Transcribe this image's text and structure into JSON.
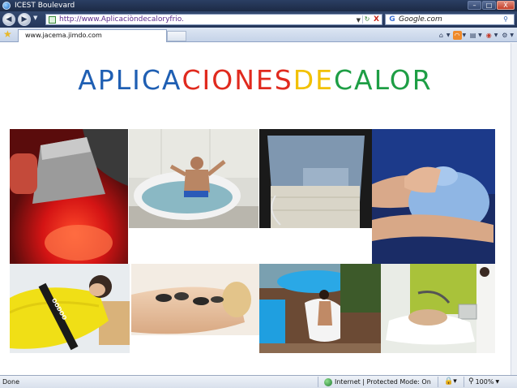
{
  "window": {
    "title": "ICEST Boulevard",
    "buttons": {
      "minimize": "–",
      "maximize": "□",
      "close": "X"
    }
  },
  "address_bar": {
    "url": "http://www.Aplicaciòndecaloryfrio.",
    "refresh_glyph": "↻",
    "stop_glyph": "X"
  },
  "search": {
    "value": "Google.com",
    "button_glyph": "⚲"
  },
  "tabs": [
    {
      "label": "www.jacema.jimdo.com"
    }
  ],
  "page": {
    "title_parts": [
      {
        "text": "APLICA",
        "color": "#1f5fb3"
      },
      {
        "text": "CIONES",
        "color": "#e02a1e"
      },
      {
        "text": " ",
        "color": "#000000"
      },
      {
        "text": "DE",
        "color": "#f2c100"
      },
      {
        "text": " ",
        "color": "#000000"
      },
      {
        "text": "CALOR",
        "color": "#1e9e45"
      }
    ]
  },
  "photos": [
    {
      "name": "infrared-lamp-photo"
    },
    {
      "name": "whirlpool-tub-photo"
    },
    {
      "name": "heating-pad-photo"
    },
    {
      "name": "hot-water-bag-photo"
    },
    {
      "name": "wrap-treatment-photo",
      "label": "OODOO"
    },
    {
      "name": "hot-stone-massage-photo"
    },
    {
      "name": "pool-spa-photo"
    },
    {
      "name": "therapy-room-photo"
    }
  ],
  "status_bar": {
    "text": "Done",
    "zone": "Internet | Protected Mode: On",
    "zoom": "100%"
  },
  "colors": {
    "chrome_dark": "#24365a",
    "tab_bar": "#c5d3e8",
    "link_purple": "#5a2a8c"
  }
}
